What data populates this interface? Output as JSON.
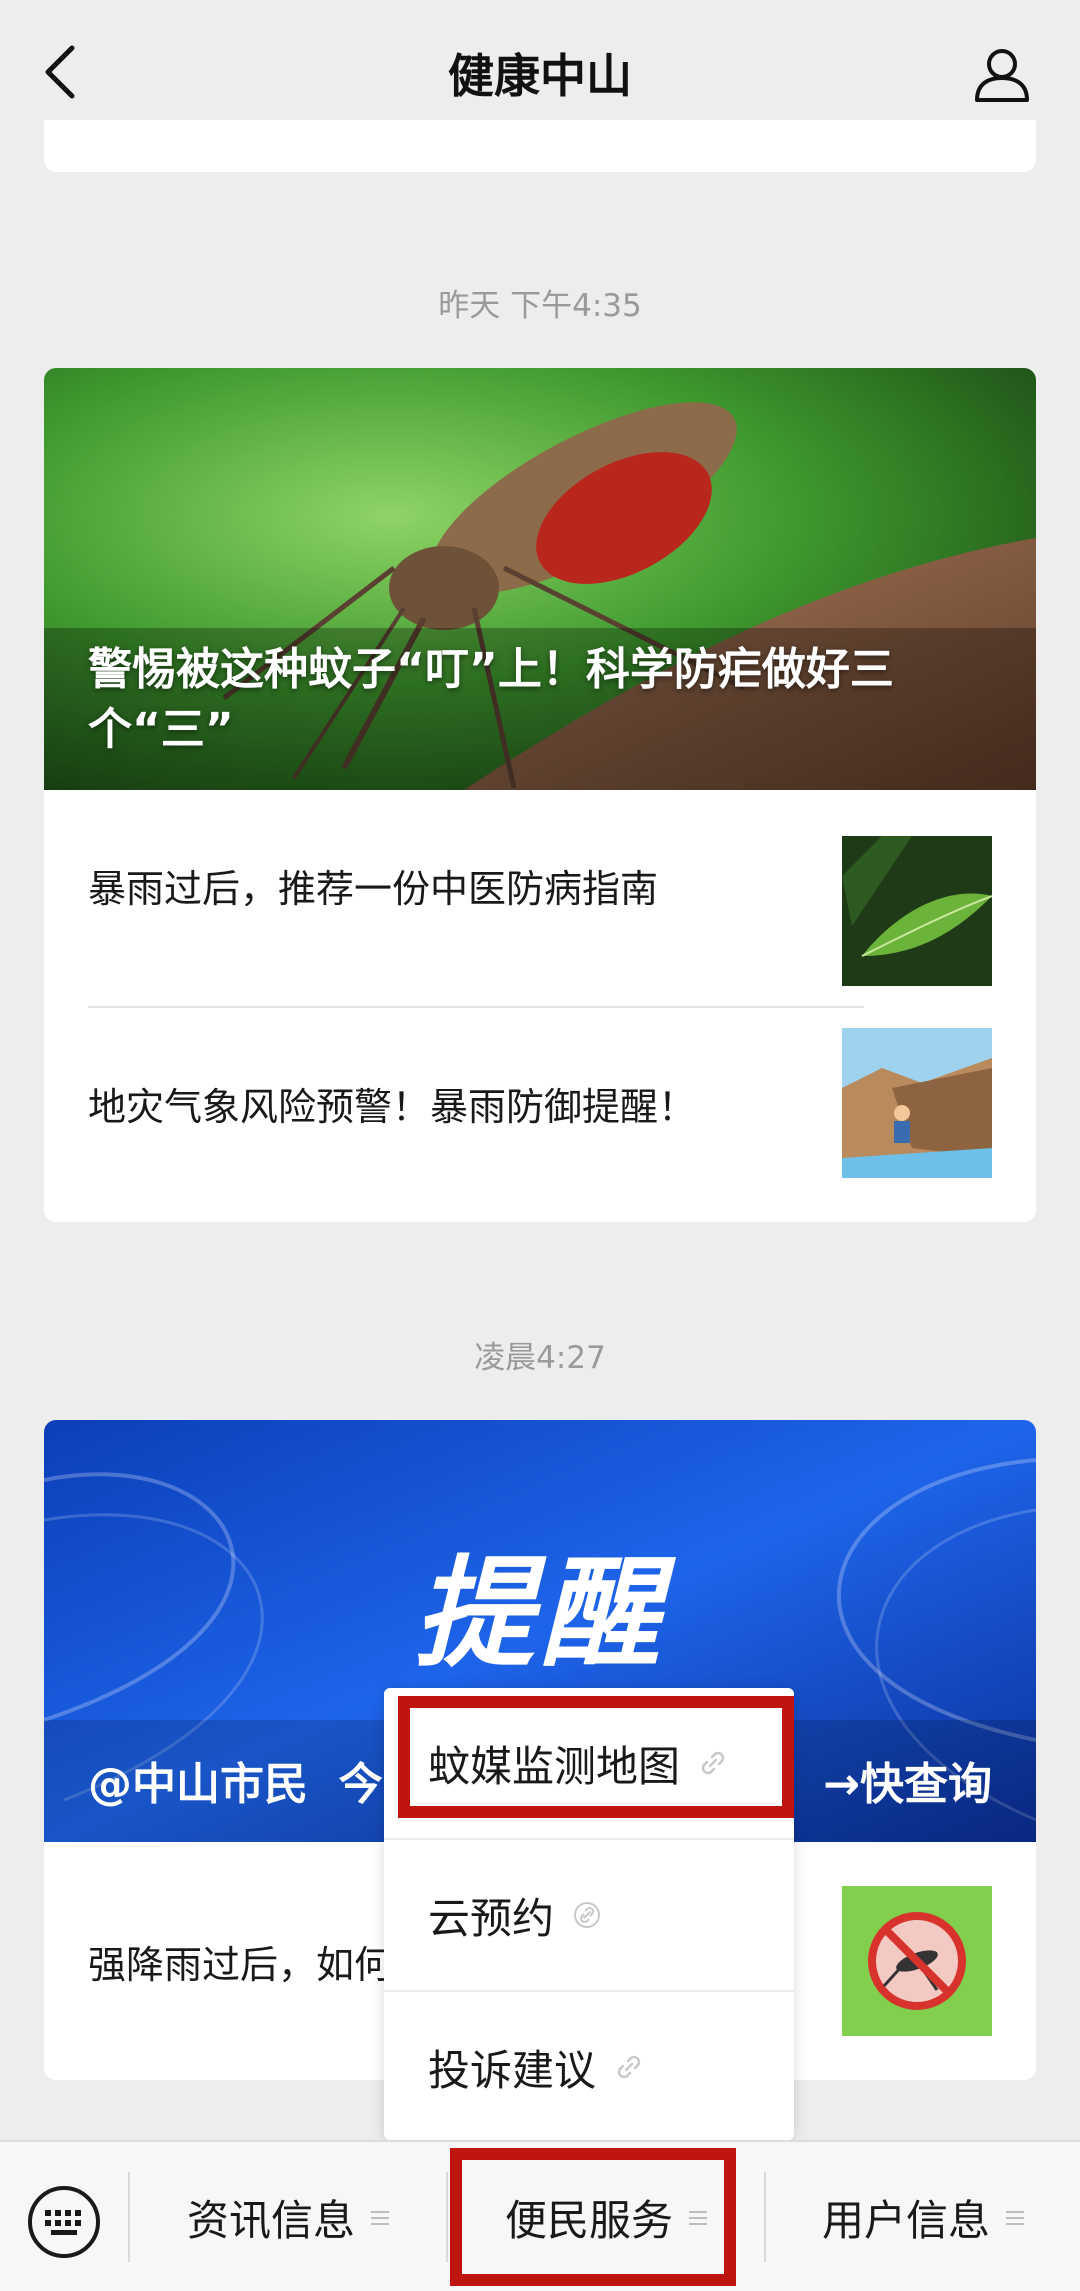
{
  "header": {
    "title": "健康中山",
    "back_icon": "back-arrow-icon",
    "profile_icon": "user-profile-icon"
  },
  "messages": [
    {
      "timestamp": "昨天 下午4:35",
      "hero_title": "警惕被这种蚊子“叮”上！科学防疟做好三个“三”",
      "items": [
        {
          "text": "暴雨过后，推荐一份中医防病指南"
        },
        {
          "text": "地灾气象风险预警！暴雨防御提醒！"
        }
      ]
    },
    {
      "timestamp": "凌晨4:27",
      "hero_banner": "提醒",
      "hero_title_left": "@中山市民  今",
      "hero_title_right": "→快查询",
      "items": [
        {
          "text": "强降雨过后，如何"
        }
      ]
    }
  ],
  "popup_menu": {
    "items": [
      {
        "label": "蚊媒监测地图",
        "icon": "link-icon"
      },
      {
        "label": "云预约",
        "icon": "link-icon"
      },
      {
        "label": "投诉建议",
        "icon": "link-icon"
      }
    ]
  },
  "bottom_bar": {
    "keyboard_icon": "keyboard-icon",
    "tabs": [
      {
        "label": "资讯信息"
      },
      {
        "label": "便民服务"
      },
      {
        "label": "用户信息"
      }
    ]
  },
  "colors": {
    "highlight": "#c0140f",
    "background": "#ededed"
  }
}
